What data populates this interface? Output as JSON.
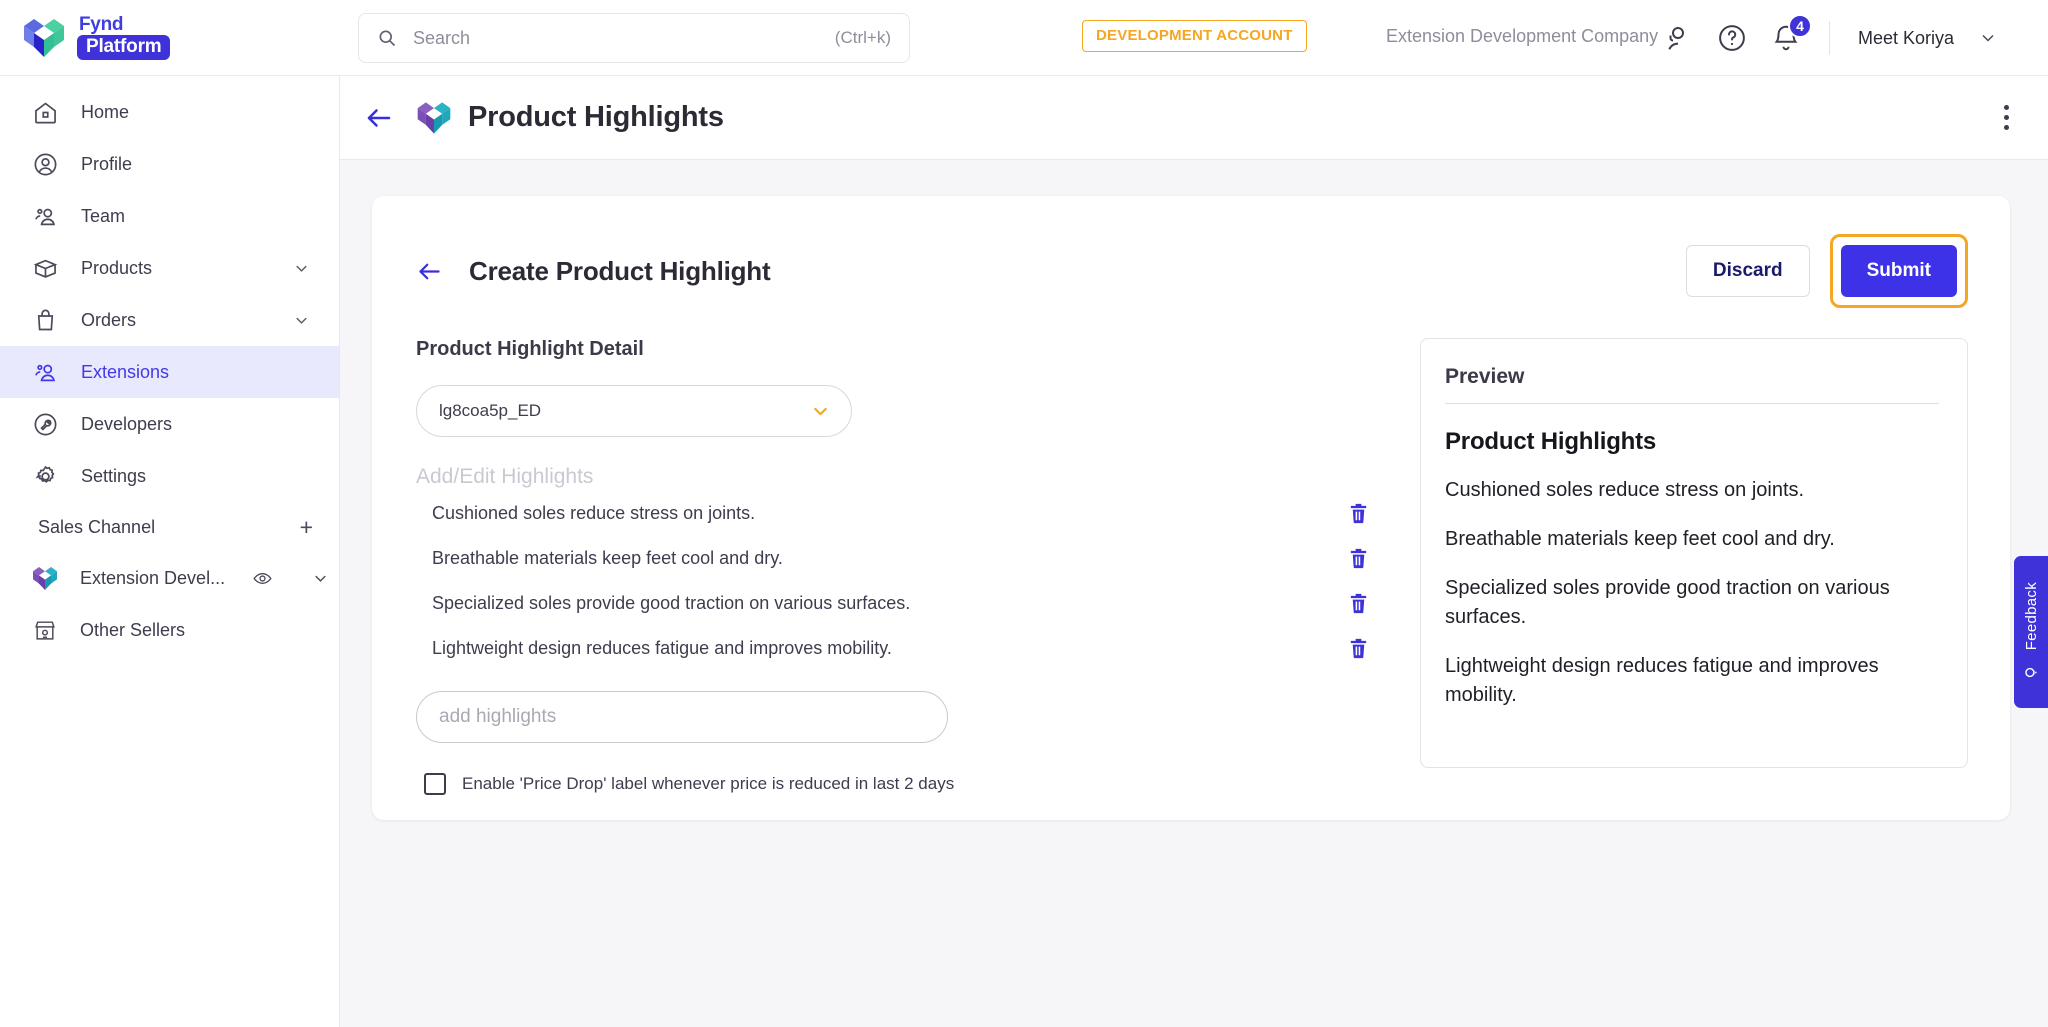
{
  "brand": {
    "line1": "Fynd",
    "line2": "Platform"
  },
  "search": {
    "placeholder": "Search",
    "value": "",
    "shortcut": "(Ctrl+k)"
  },
  "header": {
    "dev_badge": "DEVELOPMENT ACCOUNT",
    "company": "Extension Development Company",
    "notification_count": "4",
    "user_name": "Meet Koriya",
    "accent_blue": "#3e32d8",
    "accent_orange": "#f5a623"
  },
  "sidebar": {
    "items": [
      {
        "label": "Home",
        "icon": "home-icon",
        "active": false,
        "chevron": false
      },
      {
        "label": "Profile",
        "icon": "profile-icon",
        "active": false,
        "chevron": false
      },
      {
        "label": "Team",
        "icon": "team-icon",
        "active": false,
        "chevron": false
      },
      {
        "label": "Products",
        "icon": "box-icon",
        "active": false,
        "chevron": true
      },
      {
        "label": "Orders",
        "icon": "bag-icon",
        "active": false,
        "chevron": true
      },
      {
        "label": "Extensions",
        "icon": "extensions-icon",
        "active": true,
        "chevron": false
      },
      {
        "label": "Developers",
        "icon": "wrench-icon",
        "active": false,
        "chevron": false
      },
      {
        "label": "Settings",
        "icon": "gear-icon",
        "active": false,
        "chevron": false
      }
    ],
    "section": {
      "label": "Sales Channel",
      "add": "+"
    },
    "channel": {
      "label": "Extension Devel...",
      "icon": "fynd-heart-icon"
    },
    "other_sellers": {
      "label": "Other Sellers",
      "icon": "storefront-icon"
    }
  },
  "page": {
    "title": "Product Highlights",
    "back_icon": "back-arrow-icon",
    "menu_icon": "kebab-menu-icon"
  },
  "card": {
    "title": "Create Product Highlight",
    "discard_label": "Discard",
    "submit_label": "Submit",
    "form_section_title": "Product Highlight Detail",
    "select_value": "lg8coa5p_ED",
    "add_edit_label": "Add/Edit Highlights",
    "highlights": [
      "Cushioned soles reduce stress on joints.",
      "Breathable materials keep feet cool and dry.",
      "Specialized soles provide good traction on various surfaces.",
      "Lightweight design reduces fatigue and improves mobility."
    ],
    "add_input_placeholder": "add highlights",
    "add_input_value": "",
    "checkbox_label": "Enable 'Price Drop' label whenever price is reduced in last 2 days",
    "checkbox_checked": false
  },
  "preview": {
    "head": "Preview",
    "title": "Product Highlights",
    "lines": [
      "Cushioned soles reduce stress on joints.",
      "Breathable materials keep feet cool and dry.",
      "Specialized soles provide good traction on various surfaces.",
      "Lightweight design reduces fatigue and improves mobility."
    ]
  },
  "feedback": {
    "label": "Feedback",
    "icon": "megaphone-icon"
  }
}
